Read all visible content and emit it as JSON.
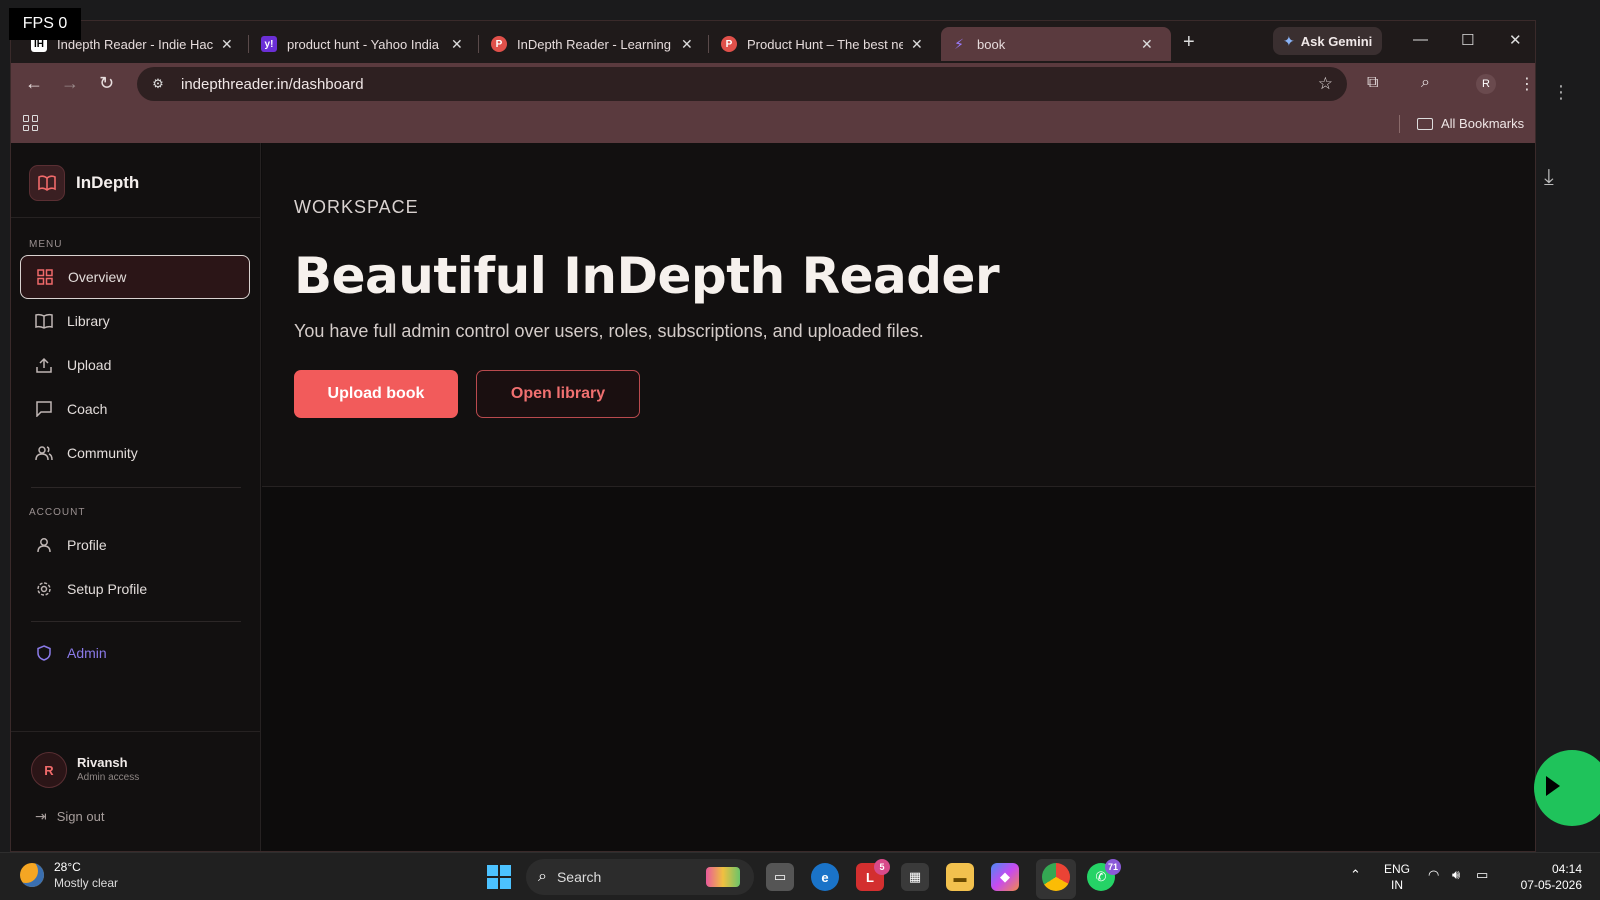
{
  "overlay": {
    "fps": "FPS 0"
  },
  "browser": {
    "tabs": [
      {
        "label": "Indepth Reader - Indie Hack",
        "icon": "IH",
        "icon_color": "#ffffff",
        "active": false
      },
      {
        "label": "product hunt - Yahoo India S",
        "icon": "y!",
        "icon_color": "#6b2fd6",
        "active": false
      },
      {
        "label": "InDepth Reader - Learning n",
        "icon": "P",
        "icon_color": "#e0504a",
        "active": false
      },
      {
        "label": "Product Hunt – The best nev",
        "icon": "P",
        "icon_color": "#e0504a",
        "active": false
      },
      {
        "label": "book",
        "icon": "⚡",
        "icon_color": "#7b5cf0",
        "active": true
      }
    ],
    "new_tab": "+",
    "gemini": "Ask Gemini",
    "url": "indepthreader.in/dashboard",
    "profile_initial": "R",
    "all_bookmarks": "All Bookmarks"
  },
  "app": {
    "brand": "InDepth",
    "menu_label": "MENU",
    "menu": [
      {
        "label": "Overview",
        "icon": "grid-icon",
        "active": true
      },
      {
        "label": "Library",
        "icon": "book-icon",
        "active": false
      },
      {
        "label": "Upload",
        "icon": "upload-icon",
        "active": false
      },
      {
        "label": "Coach",
        "icon": "chat-icon",
        "active": false
      },
      {
        "label": "Community",
        "icon": "users-icon",
        "active": false
      }
    ],
    "account_label": "ACCOUNT",
    "account": [
      {
        "label": "Profile",
        "icon": "user-icon"
      },
      {
        "label": "Setup Profile",
        "icon": "gear-icon"
      }
    ],
    "admin": {
      "label": "Admin",
      "icon": "shield-icon"
    },
    "user": {
      "initial": "R",
      "name": "Rivansh",
      "role": "Admin access"
    },
    "sign_out": "Sign out",
    "hero": {
      "eyebrow": "WORKSPACE",
      "title": "Beautiful InDepth Reader",
      "subtitle": "You have full admin control over users, roles, subscriptions, and uploaded files.",
      "primary_button": "Upload book",
      "secondary_button": "Open library"
    },
    "accent_color": "#f25b5b",
    "admin_color": "#8a7ae8"
  },
  "taskbar": {
    "weather_temp": "28°C",
    "weather_cond": "Mostly clear",
    "search_placeholder": "Search",
    "badge_l": "5",
    "badge_whatsapp": "71",
    "lang_1": "ENG",
    "lang_2": "IN",
    "time": "04:14",
    "date": "07-05-2026"
  }
}
